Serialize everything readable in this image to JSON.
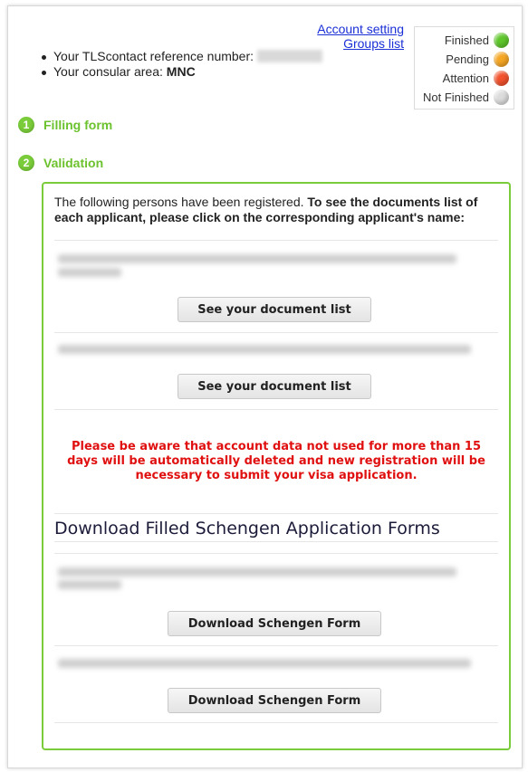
{
  "header": {
    "links": [
      "Account setting",
      "Groups list"
    ],
    "reference_label": "Your TLScontact reference number:",
    "consular_label": "Your consular area:",
    "consular_value": "MNC"
  },
  "legend": [
    {
      "label": "Finished",
      "color": "#5ec62b"
    },
    {
      "label": "Pending",
      "color": "#f5a623"
    },
    {
      "label": "Attention",
      "color": "#f2522d"
    },
    {
      "label": "Not Finished",
      "color": "#dcdcdc"
    }
  ],
  "steps": [
    {
      "num": "1",
      "label": "Filling form"
    },
    {
      "num": "2",
      "label": "Validation"
    }
  ],
  "panel": {
    "intro_plain": "The following persons have been registered. ",
    "intro_bold": "To see the documents list of each applicant, please click on the corresponding applicant's name:",
    "document_button": "See your document list",
    "warning": "Please be aware that account data not used for more than 15 days will be automatically deleted and new registration will be necessary to submit your visa application.",
    "download_title": "Download Filled Schengen Application Forms",
    "download_button": "Download Schengen Form"
  }
}
